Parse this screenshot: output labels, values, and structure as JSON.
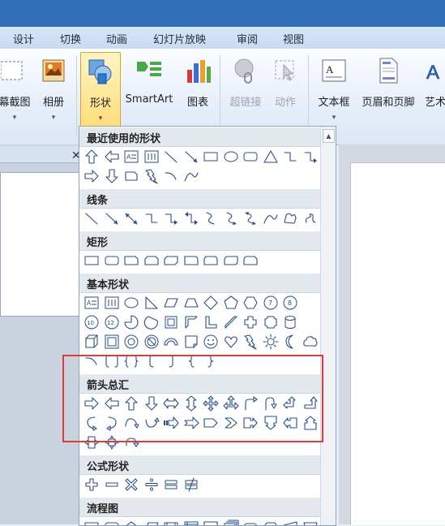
{
  "menu_tabs": [
    "设计",
    "切换",
    "动画",
    "幻灯片放映",
    "审阅",
    "视图"
  ],
  "ribbon": {
    "screenshot_label": "幕截图",
    "album_label": "相册",
    "shapes_label": "形状",
    "smartart_label": "SmartArt",
    "chart_label": "图表",
    "hyperlink_label": "超链接",
    "action_label": "动作",
    "textbox_label": "文本框",
    "header_footer_label": "页眉和页脚",
    "wordart_label": "艺术",
    "dropdown_arrow": "▾"
  },
  "panel": {
    "close_glyph": "✕"
  },
  "gallery": {
    "scroll_up_glyph": "▲",
    "sections": [
      {
        "title": "最近使用的形状",
        "rows": [
          [
            "arrow-up",
            "arrow-left",
            "textbox",
            "textbox-v",
            "line",
            "line-arrow",
            "rect",
            "oval",
            "rounded-rect",
            "triangle",
            "elbow",
            "elbow-arrow"
          ],
          [
            "arrow-right",
            "arrow-down",
            "snip-rect",
            "lightning",
            "arc",
            "curve"
          ]
        ]
      },
      {
        "title": "线条",
        "rows": [
          [
            "line",
            "line-arrow",
            "line-double-arrow",
            "elbow",
            "elbow-arrow",
            "elbow-double",
            "curve-connector",
            "curve-arrow",
            "curve-double",
            "curve",
            "freeform",
            "scribble"
          ]
        ]
      },
      {
        "title": "矩形",
        "rows": [
          [
            "rect",
            "rounded-rect",
            "snip-corner",
            "snip-two",
            "snip-diag",
            "round-corner",
            "round-two",
            "round-diag",
            "round-snip"
          ]
        ]
      },
      {
        "title": "基本形状",
        "rows": [
          [
            "textbox",
            "textbox-v",
            "oval",
            "right-triangle",
            "parallelogram",
            "trapezoid",
            "diamond",
            "pentagon",
            "hexagon",
            "heptagon",
            "octagon"
          ],
          [
            "decagon",
            "dodecagon",
            "pie",
            "chord",
            "frame",
            "half-frame",
            "l-shape",
            "diagonal-stripe",
            "cross",
            "plaque",
            "can"
          ],
          [
            "cube",
            "bevel",
            "donut",
            "no-symbol",
            "block-arc",
            "folded-corner",
            "smiley",
            "heart",
            "lightning",
            "sun",
            "moon",
            "cloud"
          ],
          [
            "arc",
            "bracket-pair",
            "brace-pair",
            "left-bracket",
            "right-bracket",
            "left-brace",
            "right-brace"
          ]
        ]
      },
      {
        "title": "箭头总汇",
        "rows": [
          [
            "arrow-right",
            "arrow-left",
            "arrow-up",
            "arrow-down",
            "arrow-left-right",
            "arrow-up-down",
            "arrow-quad",
            "arrow-left-right-up",
            "arrow-bent",
            "arrow-u-turn",
            "arrow-left-up",
            "arrow-bent-up"
          ],
          [
            "arrow-curved-right",
            "arrow-curved-left",
            "arrow-curved-up",
            "arrow-curved-down",
            "arrow-striped-right",
            "arrow-notched-right",
            "pentagon-arrow",
            "chevron",
            "callout-right",
            "callout-down",
            "callout-left",
            "callout-up"
          ],
          [
            "callout-left-right",
            "callout-quad",
            "arrow-circular"
          ]
        ]
      },
      {
        "title": "公式形状",
        "rows": [
          [
            "math-plus",
            "math-minus",
            "math-multiply",
            "math-divide",
            "math-equal",
            "math-not-equal"
          ]
        ]
      },
      {
        "title": "流程图",
        "rows": [
          [
            "flow-process",
            "flow-alt-process",
            "flow-decision",
            "flow-data",
            "flow-predefined",
            "flow-internal-storage",
            "flow-document",
            "flow-multidocument",
            "flow-terminator",
            "flow-preparation",
            "flow-manual-input",
            "flow-manual-operation"
          ]
        ]
      }
    ]
  }
}
